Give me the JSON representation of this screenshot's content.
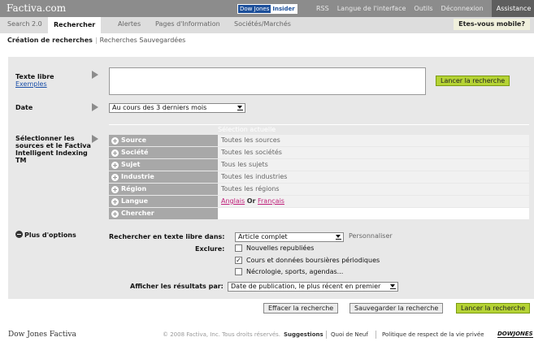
{
  "header": {
    "brand": "Factiva.com",
    "badge_a": "Dow Jones",
    "badge_b": "Insider",
    "links": [
      "RSS",
      "Langue de l'interface",
      "Outils",
      "Déconnexion"
    ],
    "help": "Assistance"
  },
  "nav": {
    "tabs": [
      "Search 2.0",
      "Rechercher",
      "Alertes",
      "Pages d'Information",
      "Sociétés/Marchés"
    ],
    "active_tab": "Rechercher",
    "mobile": "Etes-vous mobile?"
  },
  "subnav": {
    "current": "Création de recherches",
    "other": "Recherches Sauvegardées"
  },
  "form": {
    "freetext_label": "Texte libre",
    "examples_link": "Exemples",
    "launch_label": "Lancer la recherche",
    "date_label": "Date",
    "date_value": "Au cours des 3 derniers mois",
    "sources_label": "Sélectionner les sources et le Factiva Intelligent Indexing TM",
    "selection_header": "Sélection actuelle",
    "rows": [
      {
        "name": "Source",
        "value": "Toutes les sources"
      },
      {
        "name": "Société",
        "value": "Toutes les sociétés"
      },
      {
        "name": "Sujet",
        "value": "Tous les sujets"
      },
      {
        "name": "Industrie",
        "value": "Toutes les industries"
      },
      {
        "name": "Région",
        "value": "Toutes les régions"
      },
      {
        "name": "Langue",
        "value": ""
      },
      {
        "name": "Chercher",
        "value": ""
      }
    ],
    "langue": {
      "lang1": "Anglais",
      "or": "Or",
      "lang2": "Français"
    },
    "more_options": "Plus d'options",
    "search_in_label": "Rechercher en texte libre dans:",
    "search_in_value": "Article complet",
    "personnaliser": "Personnaliser",
    "exclude_label": "Exclure:",
    "exclusions": [
      {
        "label": "Nouvelles republiées",
        "checked": false
      },
      {
        "label": "Cours et données boursières périodiques",
        "checked": true
      },
      {
        "label": "Nécrologie, sports, agendas...",
        "checked": false
      }
    ],
    "display_label": "Afficher les résultats par:",
    "display_value": "Date de publication, le plus récent en premier",
    "clear_label": "Effacer la recherche",
    "save_label": "Sauvegarder la recherche",
    "launch_bottom_label": "Lancer la recherche"
  },
  "footer": {
    "brand": "Dow Jones Factiva",
    "copyright": "© 2008 Factiva, Inc. Tous droits réservés.",
    "suggestions": "Suggestions",
    "whats_new": "Quoi de Neuf",
    "privacy": "Politique de respect de la vie privée",
    "logo": "DOWJONES"
  },
  "colors": {
    "accent_green": "#b5d334",
    "header_grey": "#8c8c8c",
    "link_blue": "#1a4fa8",
    "lang_link": "#c0207a"
  }
}
